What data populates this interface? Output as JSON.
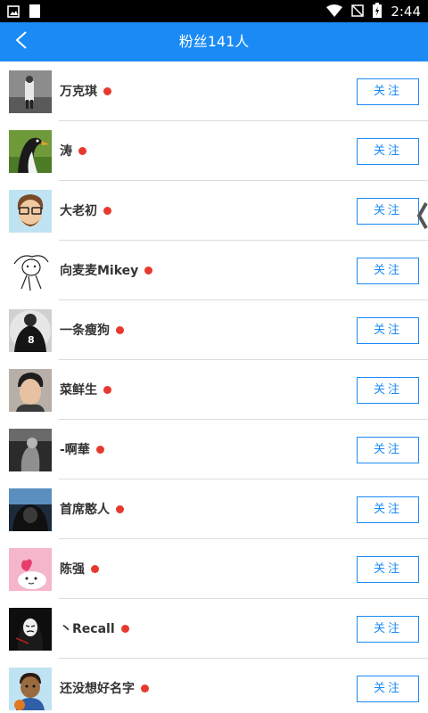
{
  "status_bar": {
    "time": "2:44",
    "icons": [
      "image-icon",
      "sd-card-icon",
      "wifi-icon",
      "no-signal-icon",
      "battery-charging-icon"
    ]
  },
  "header": {
    "title": "粉丝141人",
    "back_icon": "chevron-left-icon",
    "color": "#1a8af5"
  },
  "fans": [
    {
      "name": "万克琪",
      "button": "关注",
      "avatar": "person-street"
    },
    {
      "name": "涛",
      "button": "关注",
      "avatar": "penguin"
    },
    {
      "name": "大老初",
      "button": "关注",
      "avatar": "cartoon-glasses-man"
    },
    {
      "name": "向麦麦Mikey",
      "button": "关注",
      "avatar": "sketch-doodle"
    },
    {
      "name": "一条瘦狗",
      "button": "关注",
      "avatar": "jersey-8"
    },
    {
      "name": "菜鲜生",
      "button": "关注",
      "avatar": "portrait"
    },
    {
      "name": "-啊華",
      "button": "关注",
      "avatar": "dark-photo"
    },
    {
      "name": "首席憨人",
      "button": "关注",
      "avatar": "city-night"
    },
    {
      "name": "陈强",
      "button": "关注",
      "avatar": "pink-cartoon"
    },
    {
      "name": "丶Recall",
      "button": "关注",
      "avatar": "mask-figure"
    },
    {
      "name": "还没想好名字",
      "button": "关注",
      "avatar": "basketball-cartoon"
    }
  ],
  "colors": {
    "accent": "#1a8af5",
    "online_dot": "#e8392e",
    "divider": "#dcdcdc"
  }
}
